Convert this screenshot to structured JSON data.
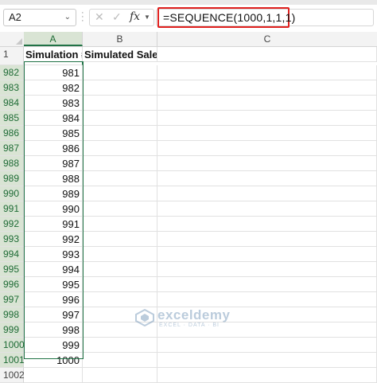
{
  "formula_bar": {
    "name_box": "A2",
    "cancel_icon": "✕",
    "enter_icon": "✓",
    "fx_label": "fx",
    "formula": "=SEQUENCE(1000,1,1,1)"
  },
  "columns": [
    "A",
    "B",
    "C"
  ],
  "selected_column": "A",
  "header_row": {
    "row_number": "1",
    "a": "Simulation #",
    "b": "Simulated Sales"
  },
  "rows": [
    {
      "num": "982",
      "a": "981"
    },
    {
      "num": "983",
      "a": "982"
    },
    {
      "num": "984",
      "a": "983"
    },
    {
      "num": "985",
      "a": "984"
    },
    {
      "num": "986",
      "a": "985"
    },
    {
      "num": "987",
      "a": "986"
    },
    {
      "num": "988",
      "a": "987"
    },
    {
      "num": "989",
      "a": "988"
    },
    {
      "num": "990",
      "a": "989"
    },
    {
      "num": "991",
      "a": "990"
    },
    {
      "num": "992",
      "a": "991"
    },
    {
      "num": "993",
      "a": "992"
    },
    {
      "num": "994",
      "a": "993"
    },
    {
      "num": "995",
      "a": "994"
    },
    {
      "num": "996",
      "a": "995"
    },
    {
      "num": "997",
      "a": "996"
    },
    {
      "num": "998",
      "a": "997"
    },
    {
      "num": "999",
      "a": "998"
    },
    {
      "num": "1000",
      "a": "999"
    },
    {
      "num": "1001",
      "a": "1000"
    },
    {
      "num": "1002",
      "a": ""
    }
  ],
  "watermark": {
    "name": "exceldemy",
    "tagline": "EXCEL · DATA · BI"
  },
  "colors": {
    "accent": "#217346",
    "formula_highlight": "#e0201e"
  }
}
